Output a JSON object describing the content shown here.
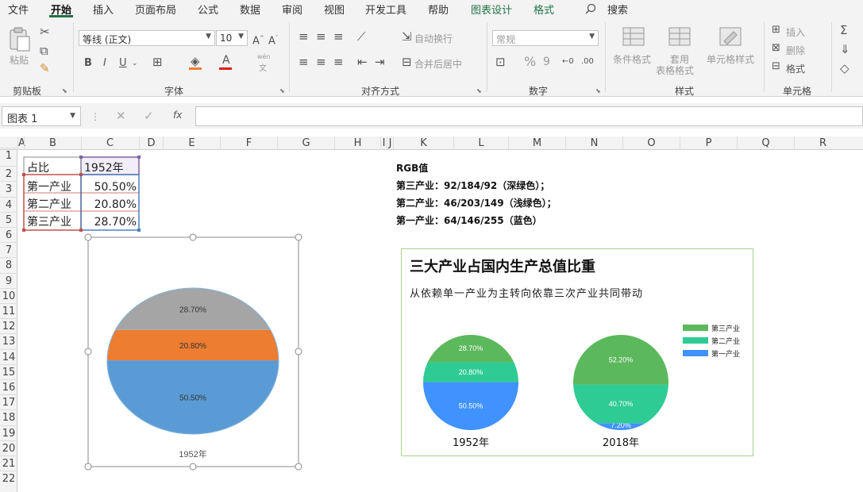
{
  "menu": {
    "tabs": [
      "文件",
      "开始",
      "插入",
      "页面布局",
      "公式",
      "数据",
      "审阅",
      "视图",
      "开发工具",
      "帮助",
      "图表设计",
      "格式"
    ],
    "search": "搜索"
  },
  "ribbon": {
    "clipboard": {
      "paste": "粘贴",
      "label": "剪贴板"
    },
    "font": {
      "name": "等线 (正文)",
      "size": "10",
      "bold": "B",
      "italic": "I",
      "underline": "U",
      "label": "字体",
      "wen": "wén",
      "wen2": "文"
    },
    "alignment": {
      "wrap": "自动换行",
      "merge": "合并后居中",
      "label": "对齐方式"
    },
    "number": {
      "format": "常规",
      "percent": "%",
      "comma": "9",
      "label": "数字"
    },
    "styles": {
      "cond": "条件格式",
      "table1": "套用",
      "table2": "表格格式",
      "cell": "单元格样式",
      "label": "样式"
    },
    "cells": {
      "insert": "插入",
      "delete": "删除",
      "format": "格式",
      "label": "单元格"
    }
  },
  "formula": {
    "namebox": "图表 1",
    "fx": "fx"
  },
  "columns": [
    "A",
    "B",
    "C",
    "D",
    "E",
    "F",
    "G",
    "H",
    "I",
    "J",
    "K",
    "L",
    "M",
    "N",
    "O",
    "P",
    "Q",
    "R"
  ],
  "rows": [
    "1",
    "2",
    "3",
    "4",
    "5",
    "6",
    "7",
    "8",
    "9",
    "10",
    "11",
    "12",
    "13",
    "14",
    "15",
    "16",
    "17",
    "18",
    "19",
    "20",
    "21",
    "22"
  ],
  "table": {
    "h1": "占比",
    "h2": "1952年",
    "r1": "第一产业",
    "v1": "50.50%",
    "r2": "第二产业",
    "v2": "20.80%",
    "r3": "第三产业",
    "v3": "28.70%"
  },
  "notes": {
    "title": "RGB值",
    "l1": "第三产业：92/184/92（深绿色）；",
    "l2": "第二产业：46/203/149（浅绿色）；",
    "l3": "第一产业：64/146/255（蓝色）"
  },
  "colors": {
    "third_dark_green": "#5cb85c",
    "second_light_green": "#2ecb95",
    "first_blue": "#4092ff",
    "chart1_gray": "#a5a5a5",
    "chart1_orange": "#ed7d31",
    "chart1_blue": "#5b9bd5",
    "accent": "#217346"
  },
  "chart_data": [
    {
      "type": "pie",
      "title": "",
      "categories": [
        "第一产业",
        "第二产业",
        "第三产业"
      ],
      "values": [
        50.5,
        20.8,
        28.7
      ],
      "labels": [
        "50.50%",
        "20.80%",
        "28.70%"
      ],
      "xlabel": "1952年"
    },
    {
      "type": "pie",
      "title": "三大产业占国内生产总值比重",
      "subtitle": "从依赖单一产业为主转向依靠三次产业共同带动",
      "legend": [
        "第三产业",
        "第二产业",
        "第一产业"
      ],
      "legend_position": "top-right",
      "series": [
        {
          "name": "1952年",
          "categories": [
            "第一产业",
            "第二产业",
            "第三产业"
          ],
          "values": [
            50.5,
            20.8,
            28.7
          ],
          "labels": [
            "50.50%",
            "20.80%",
            "28.70%"
          ]
        },
        {
          "name": "2018年",
          "categories": [
            "第一产业",
            "第二产业",
            "第三产业"
          ],
          "values": [
            7.2,
            40.7,
            52.2
          ],
          "labels": [
            "7.20%",
            "40.70%",
            "52.20%"
          ]
        }
      ]
    }
  ]
}
